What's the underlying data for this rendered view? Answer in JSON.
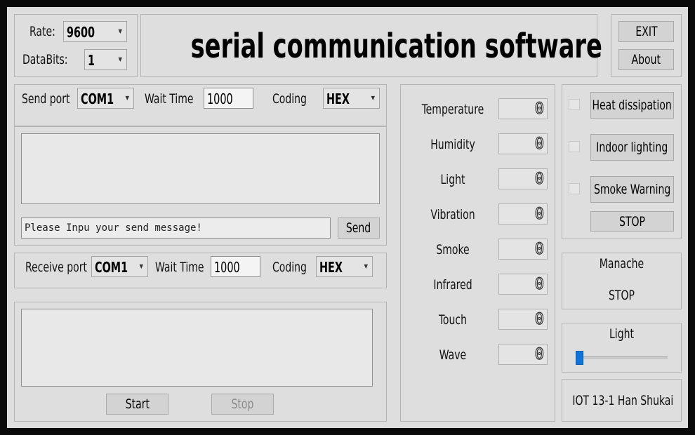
{
  "header": {
    "rate_label": "Rate:",
    "rate_value": "9600",
    "databits_label": "DataBits:",
    "databits_value": "1",
    "title": "serial communication software",
    "exit_label": "EXIT",
    "about_label": "About"
  },
  "send": {
    "port_label": "Send port",
    "port_value": "COM1",
    "wait_label": "Wait Time",
    "wait_value": "1000",
    "coding_label": "Coding",
    "coding_value": "HEX",
    "message_placeholder": "Please Inpu your send message!",
    "send_label": "Send"
  },
  "receive": {
    "port_label": "Receive port",
    "port_value": "COM1",
    "wait_label": "Wait Time",
    "wait_value": "1000",
    "coding_label": "Coding",
    "coding_value": "HEX",
    "start_label": "Start",
    "stop_label": "Stop"
  },
  "sensors": [
    {
      "label": "Temperature",
      "value": "0"
    },
    {
      "label": "Humidity",
      "value": "0"
    },
    {
      "label": "Light",
      "value": "0"
    },
    {
      "label": "Vibration",
      "value": "0"
    },
    {
      "label": "Smoke",
      "value": "0"
    },
    {
      "label": "Infrared",
      "value": "0"
    },
    {
      "label": "Touch",
      "value": "0"
    },
    {
      "label": "Wave",
      "value": "0"
    }
  ],
  "controls": {
    "heat_label": "Heat dissipation",
    "indoor_label": "Indoor lighting",
    "smoke_label": "Smoke Warning",
    "stop_label": "STOP"
  },
  "manache": {
    "title": "Manache",
    "status": "STOP"
  },
  "light_slider": {
    "label": "Light",
    "value": 0
  },
  "footer": {
    "credit": "IOT 13-1 Han Shukai"
  }
}
